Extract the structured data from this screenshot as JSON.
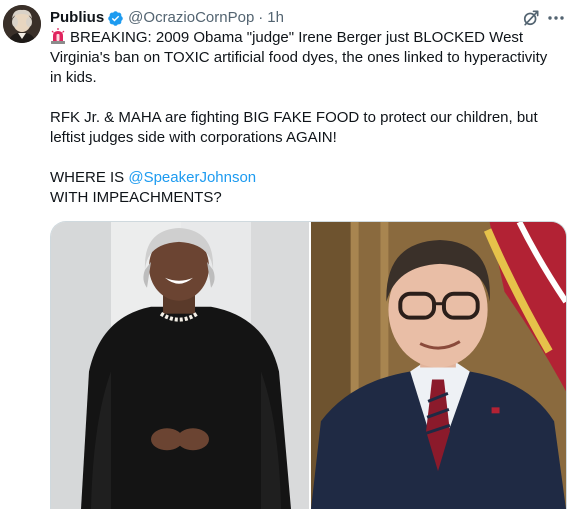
{
  "author": {
    "display_name": "Publius",
    "handle": "@OcrazioCornPop",
    "separator": "·",
    "time": "1h"
  },
  "icons": {
    "verified": "verified-badge-icon",
    "grok": "grok-icon",
    "more": "more-icon",
    "siren": "siren-emoji-icon"
  },
  "tweet": {
    "line1": "BREAKING: 2009 Obama \"judge\" Irene Berger just BLOCKED West Virginia's ban on TOXIC artificial food dyes, the ones linked to hyperactivity in kids.",
    "line2": "RFK Jr. & MAHA are fighting BIG FAKE FOOD to protect our children, but leftist judges side with corporations AGAIN!",
    "line3_prefix": "WHERE IS ",
    "line3_mention": "@SpeakerJohnson",
    "line4": "WITH IMPEACHMENTS?"
  },
  "colors": {
    "text": "#0f1419",
    "secondary": "#536471",
    "accent": "#1d9bf0",
    "siren": "#e0245e"
  }
}
